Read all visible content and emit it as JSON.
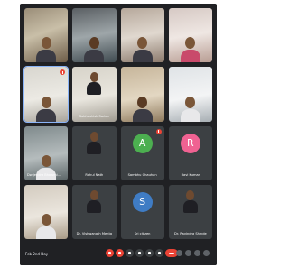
{
  "meeting": {
    "info": "Feb 2nd Day"
  },
  "participants": [
    {
      "name": ""
    },
    {
      "name": ""
    },
    {
      "name": ""
    },
    {
      "name": ""
    },
    {
      "name": ""
    },
    {
      "name": "Subhashish Sarkar"
    },
    {
      "name": ""
    },
    {
      "name": ""
    },
    {
      "name": "Dwijendra Bhowmi..."
    },
    {
      "name": "Rahul Nath"
    },
    {
      "name": "Sambhu Chauhan",
      "initial": "A",
      "color": "#4caf50"
    },
    {
      "name": "Ravi Kumar",
      "initial": "R",
      "color": "#f06292"
    },
    {
      "name": ""
    },
    {
      "name": "Dr. Vishwanath Mehta"
    },
    {
      "name": "Sri citizen",
      "initial": "S",
      "color": "#3f7cc4"
    },
    {
      "name": "Dr. Ravindra Shinde"
    }
  ],
  "colors": {
    "background": "#202124",
    "tile": "#3c4043",
    "end_call": "#ea4335",
    "active_border": "#8ab4f8"
  }
}
